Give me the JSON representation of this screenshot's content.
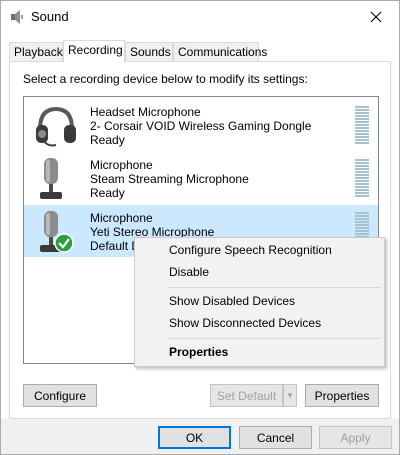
{
  "window": {
    "title": "Sound"
  },
  "tabs": [
    {
      "label": "Playback"
    },
    {
      "label": "Recording"
    },
    {
      "label": "Sounds"
    },
    {
      "label": "Communications"
    }
  ],
  "instruction": "Select a recording device below to modify its settings:",
  "devices": [
    {
      "name": "Headset Microphone",
      "description": "2- Corsair VOID Wireless Gaming Dongle",
      "status": "Ready",
      "icon": "headset-icon",
      "selected": false
    },
    {
      "name": "Microphone",
      "description": "Steam Streaming Microphone",
      "status": "Ready",
      "icon": "microphone-icon",
      "selected": false
    },
    {
      "name": "Microphone",
      "description": "Yeti Stereo Microphone",
      "status": "Default D",
      "icon": "microphone-default-icon",
      "selected": true
    }
  ],
  "context_menu": {
    "items": [
      {
        "label": "Configure Speech Recognition"
      },
      {
        "label": "Disable"
      },
      {
        "label": "Show Disabled Devices"
      },
      {
        "label": "Show Disconnected Devices"
      },
      {
        "label": "Properties"
      }
    ]
  },
  "buttons": {
    "configure": "Configure",
    "set_default": "Set Default",
    "properties": "Properties",
    "ok": "OK",
    "cancel": "Cancel",
    "apply": "Apply"
  },
  "colors": {
    "selection": "#cce8ff",
    "accent": "#0078d7",
    "check_green": "#2e9e3e"
  }
}
